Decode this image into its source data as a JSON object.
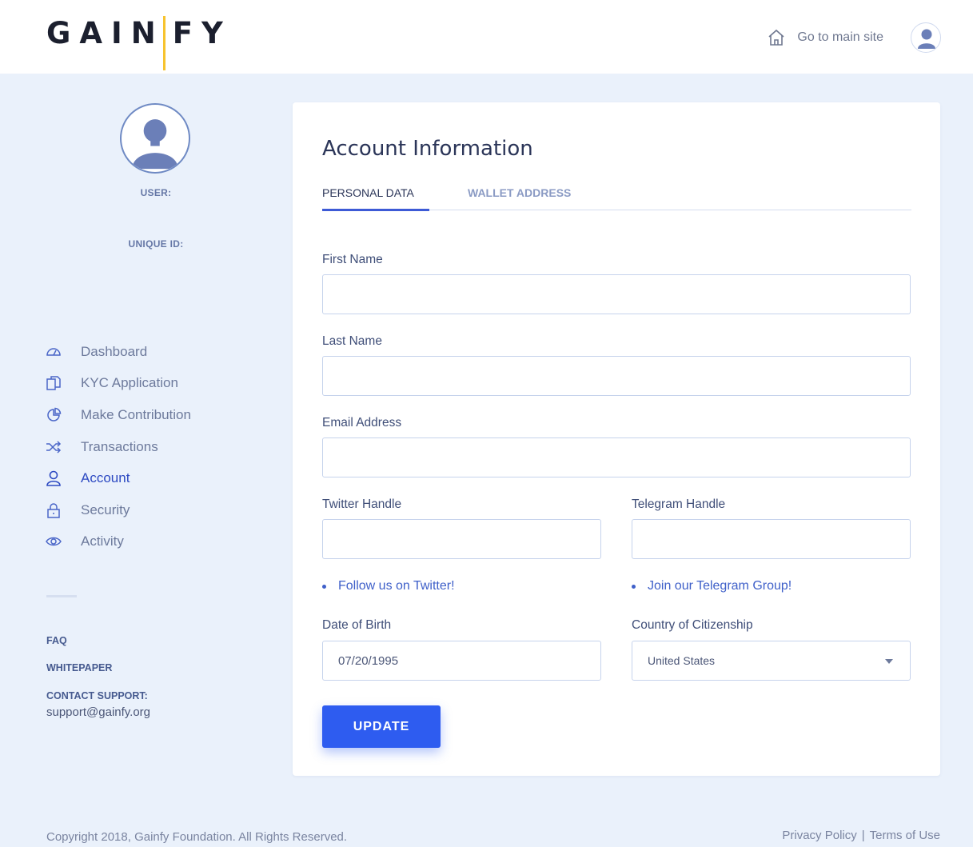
{
  "header": {
    "logo_left": "GAIN",
    "logo_right": "FY",
    "main_site_link": "Go to main site"
  },
  "sidebar": {
    "user_label": "USER:",
    "unique_id_label": "UNIQUE ID:",
    "nav": [
      {
        "label": "Dashboard",
        "icon": "dashboard-gauge-icon"
      },
      {
        "label": "KYC Application",
        "icon": "documents-icon"
      },
      {
        "label": "Make Contribution",
        "icon": "pie-chart-icon"
      },
      {
        "label": "Transactions",
        "icon": "shuffle-icon"
      },
      {
        "label": "Account",
        "icon": "user-icon",
        "active": true
      },
      {
        "label": "Security",
        "icon": "lock-icon"
      },
      {
        "label": "Activity",
        "icon": "eye-icon"
      }
    ],
    "faq": "FAQ",
    "whitepaper": "WHITEPAPER",
    "contact_label": "CONTACT SUPPORT:",
    "contact_email": "support@gainfy.org"
  },
  "card": {
    "title": "Account Information",
    "tabs": {
      "personal": "PERSONAL DATA",
      "wallet": "WALLET ADDRESS"
    },
    "fields": {
      "first_name_label": "First Name",
      "first_name_value": "",
      "last_name_label": "Last Name",
      "last_name_value": "",
      "email_label": "Email Address",
      "email_value": "",
      "twitter_label": "Twitter Handle",
      "twitter_value": "",
      "telegram_label": "Telegram Handle",
      "telegram_value": "",
      "dob_label": "Date of Birth",
      "dob_value": "07/20/1995",
      "country_label": "Country of Citizenship",
      "country_value": "United States"
    },
    "twitter_promo": "Follow us on Twitter!",
    "telegram_promo": "Join our Telegram Group!",
    "update_button": "UPDATE"
  },
  "footer": {
    "copyright": "Copyright 2018, Gainfy Foundation. All Rights Reserved.",
    "privacy": "Privacy Policy",
    "separator": "|",
    "terms": "Terms of Use"
  },
  "colors": {
    "accent": "#2e5cf0",
    "logo_bar": "#f7c32e",
    "background": "#eaf1fb"
  }
}
